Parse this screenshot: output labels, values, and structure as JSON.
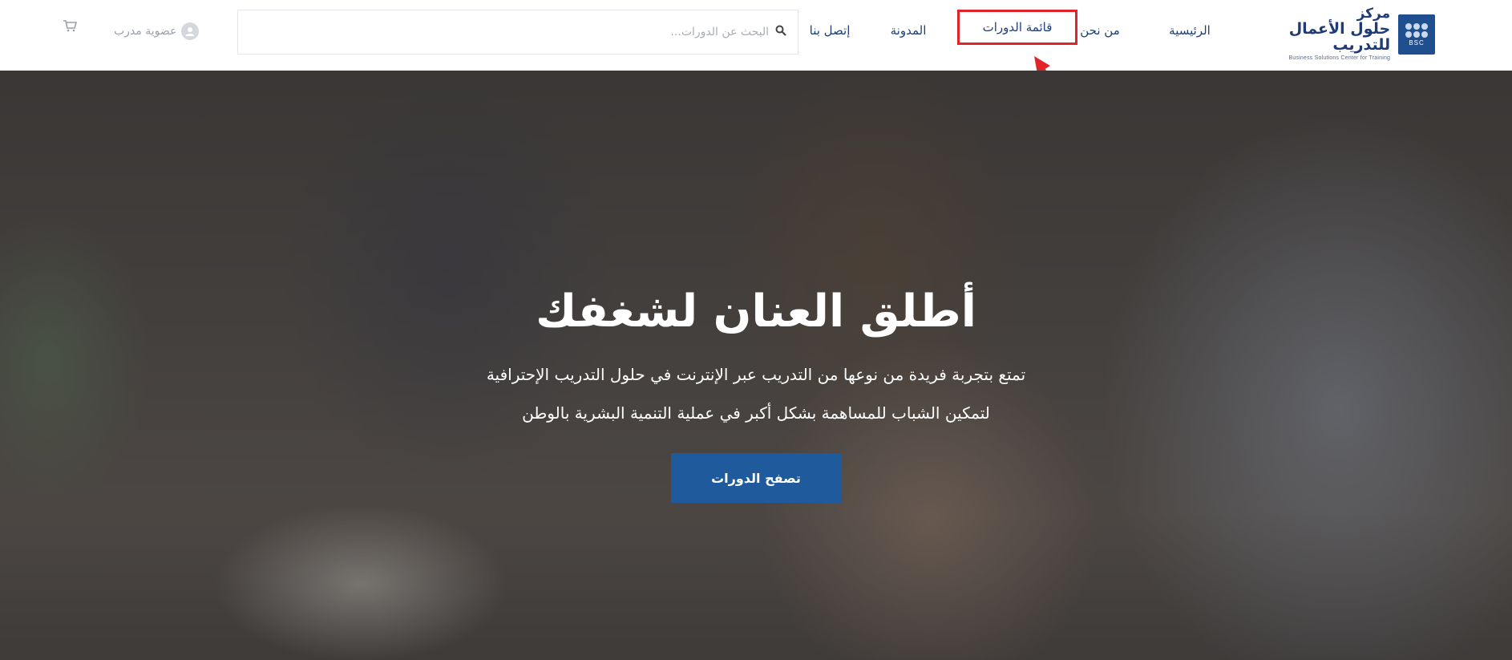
{
  "header": {
    "logo": {
      "line1": "مركز",
      "line2": "حلول الأعمال للتدريب",
      "subtitle": "Business Solutions Center for Training",
      "mark_tag": "BSC"
    },
    "nav": {
      "home": "الرئيسية",
      "about": "من نحن",
      "courses": "قائمة الدورات",
      "blog": "المدونة",
      "contact": "إتصل بنا"
    },
    "search": {
      "placeholder": "البحث عن الدورات..."
    },
    "member_label": "عضوية مدرب",
    "highlight_color": "#e0242a"
  },
  "hero": {
    "title": "أطلق العنان لشغفك",
    "subtitle_line1": "تمتع بتجربة فريدة من نوعها من التدريب عبر الإنترنت في حلول التدريب الإحترافية",
    "subtitle_line2": "لتمكين الشباب للمساهمة بشكل أكبر في عملية التنمية البشرية بالوطن",
    "button_label": "تصفح الدورات",
    "button_color": "#1f5a9c"
  },
  "icons": {
    "search": "search-icon",
    "user": "user-icon",
    "cart": "cart-icon",
    "annotation": "red-arrow-annotation"
  }
}
